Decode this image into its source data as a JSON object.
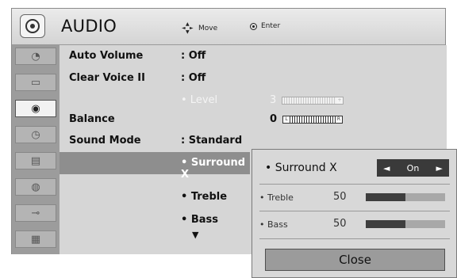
{
  "header": {
    "title": "AUDIO",
    "move_label": "Move",
    "enter_label": "Enter"
  },
  "sidebar": {
    "items": [
      {
        "icon": "satellite-dish-icon"
      },
      {
        "icon": "monitor-icon"
      },
      {
        "icon": "audio-speaker-icon",
        "active": true
      },
      {
        "icon": "clock-icon"
      },
      {
        "icon": "calendar-icon"
      },
      {
        "icon": "lock-icon"
      },
      {
        "icon": "input-plug-icon"
      },
      {
        "icon": "film-clapper-icon"
      }
    ]
  },
  "menu": {
    "auto_volume": {
      "label": "Auto Volume",
      "value": ": Off"
    },
    "clear_voice": {
      "label": "Clear Voice II",
      "value": ": Off"
    },
    "level": {
      "label": "• Level",
      "value": "3"
    },
    "balance": {
      "label": "Balance",
      "value": "0",
      "left": "L",
      "right": "R"
    },
    "sound_mode": {
      "label": "Sound Mode",
      "value": ": Standard"
    },
    "surround": {
      "value": "• Surround X"
    },
    "treble": {
      "value": "• Treble"
    },
    "bass": {
      "value": "• Bass"
    },
    "more_arrow": "▼"
  },
  "popup": {
    "title": "• Surround X",
    "spinner_value": "On",
    "spinner_left": "◄",
    "spinner_right": "►",
    "treble_label": "• Treble",
    "treble_value": "50",
    "treble_level": 0.5,
    "bass_label": "• Bass",
    "bass_value": "50",
    "bass_level": 0.5,
    "close_label": "Close"
  }
}
